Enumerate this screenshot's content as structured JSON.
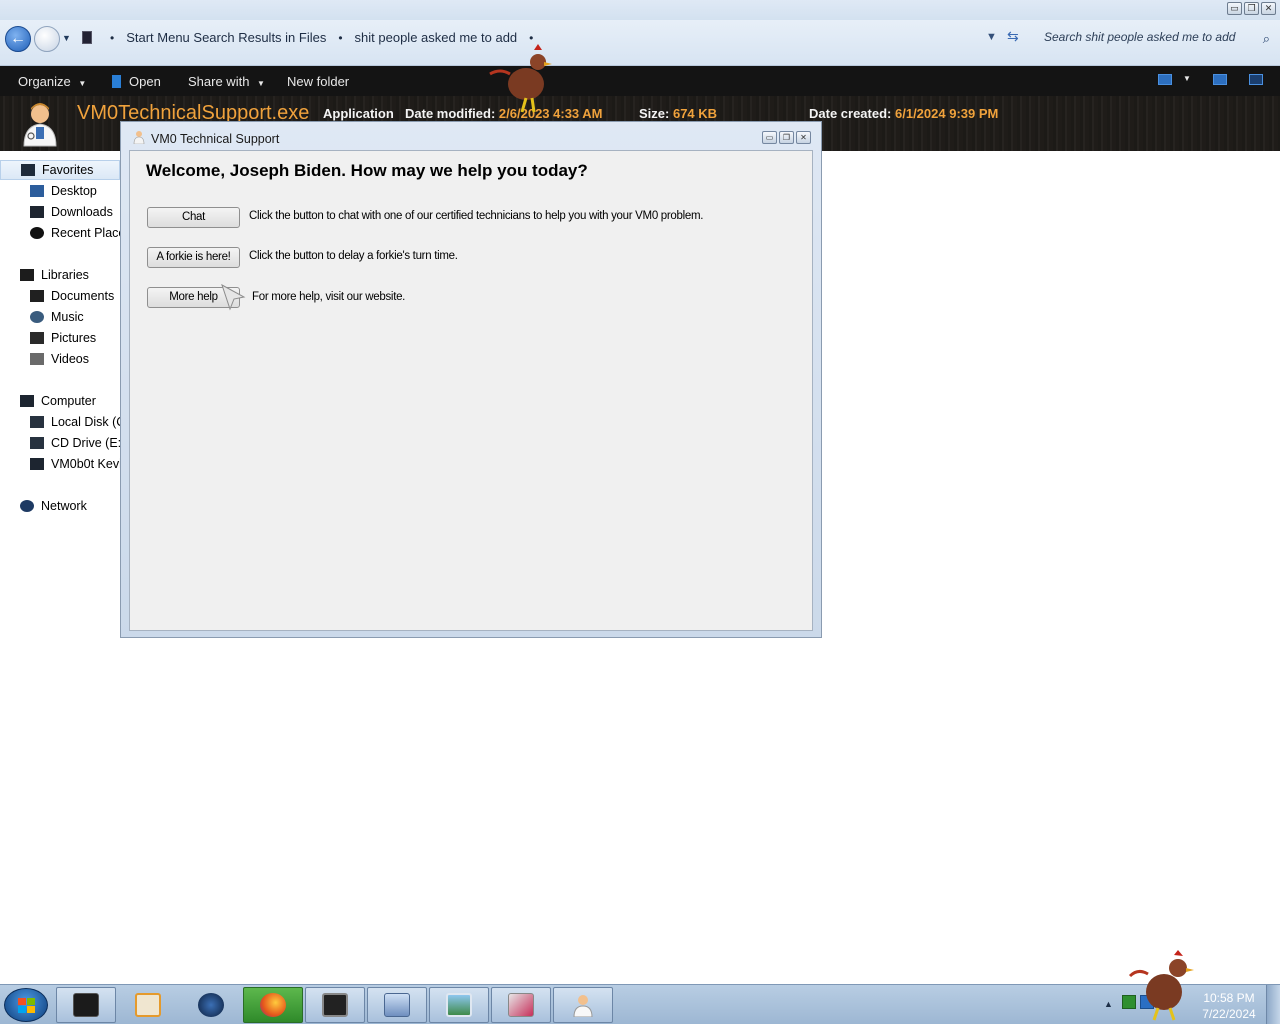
{
  "window": {
    "controls": {
      "minimize": "▭",
      "restore": "❐",
      "close": "✕"
    }
  },
  "address_bar": {
    "crumbs": [
      "Start Menu Search Results in Files",
      "shit people asked me to add"
    ],
    "separator": "•",
    "search_placeholder": "Search shit people asked me to add"
  },
  "toolbar": {
    "organize": "Organize",
    "open": "Open",
    "share_with": "Share with",
    "new_folder": "New folder"
  },
  "details": {
    "file_name": "VM0TechnicalSupport.exe",
    "file_type": "Application",
    "date_modified_label": "Date modified:",
    "date_modified": "2/6/2023 4:33 AM",
    "size_label": "Size:",
    "size": "674 KB",
    "date_created_label": "Date created:",
    "date_created": "6/1/2024 9:39 PM"
  },
  "nav_pane": {
    "favorites": "Favorites",
    "favorites_items": [
      "Desktop",
      "Downloads",
      "Recent Places"
    ],
    "libraries": "Libraries",
    "libraries_items": [
      "Documents",
      "Music",
      "Pictures",
      "Videos"
    ],
    "computer": "Computer",
    "computer_items": [
      "Local Disk (C:)",
      "CD Drive (E:)",
      "VM0b0t Kevin"
    ],
    "network": "Network"
  },
  "dialog": {
    "title": "VM0 Technical Support",
    "welcome": "Welcome, Joseph Biden. How may we help you today?",
    "buttons": [
      {
        "label": "Chat",
        "description": "Click the button to chat with one of our certified technicians to help you with your VM0 problem."
      },
      {
        "label": "A forkie is here!",
        "description": "Click the button to delay a forkie's turn time."
      },
      {
        "label": "More help",
        "description": "For more help, visit our website."
      }
    ]
  },
  "taskbar": {
    "time": "10:58 PM",
    "date": "7/22/2024",
    "apps": [
      "explorer-icon",
      "media-player-icon",
      "globe-icon",
      "firefox-icon",
      "monitor-icon",
      "keyboard-computer-icon",
      "photo-viewer-icon",
      "paint-icon",
      "tech-support-icon"
    ]
  },
  "colors": {
    "accent_orange": "#f0a23c",
    "toolbar_bg": "#141414",
    "address_bg": "#dfe9f5"
  }
}
